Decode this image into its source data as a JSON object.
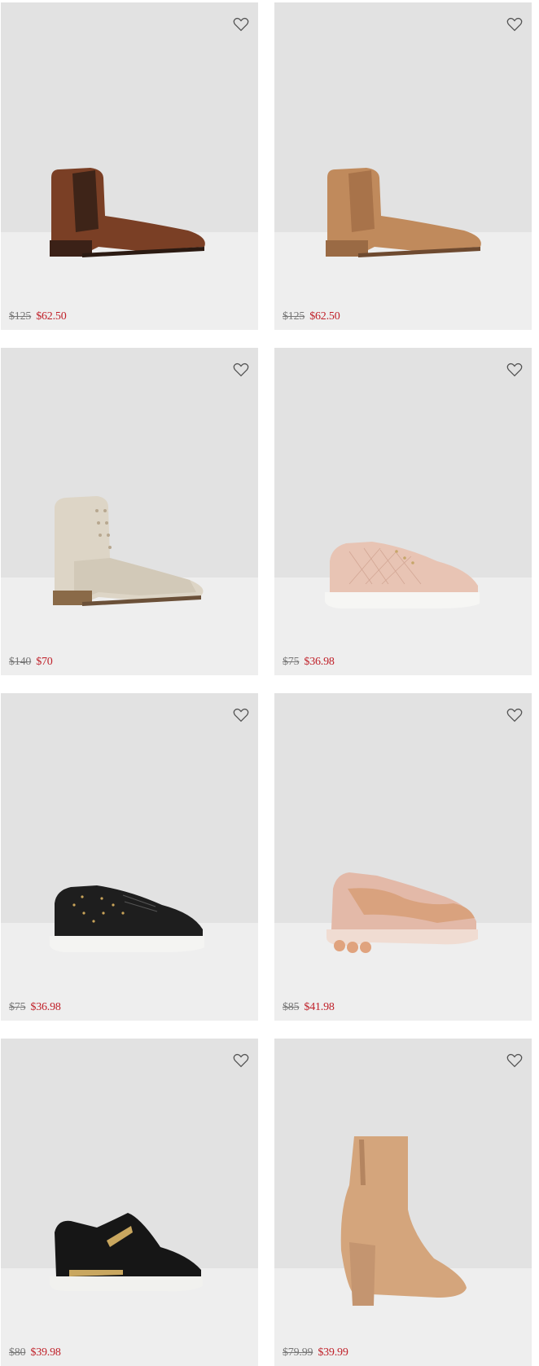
{
  "products": [
    {
      "icon": "chelsea-boot-brown",
      "original_price": "$125",
      "sale_price": "$62.50"
    },
    {
      "icon": "chelsea-boot-tan-suede",
      "original_price": "$125",
      "sale_price": "$62.50"
    },
    {
      "icon": "lace-up-boot-cream",
      "original_price": "$140",
      "sale_price": "$70"
    },
    {
      "icon": "quilted-sneaker-blush",
      "original_price": "$75",
      "sale_price": "$36.98"
    },
    {
      "icon": "quilted-sneaker-black",
      "original_price": "$75",
      "sale_price": "$36.98"
    },
    {
      "icon": "chunky-sneaker-rose-gold",
      "original_price": "$85",
      "sale_price": "$41.98"
    },
    {
      "icon": "sock-sneaker-black-gold",
      "original_price": "$80",
      "sale_price": "$39.98"
    },
    {
      "icon": "block-heel-bootie-tan",
      "original_price": "$79.99",
      "sale_price": "$39.99"
    }
  ],
  "wishlist_icon": "heart-outline-icon",
  "colors": {
    "sale": "#c0212a",
    "original": "#777777",
    "card_bg": "#e2e2e2"
  }
}
